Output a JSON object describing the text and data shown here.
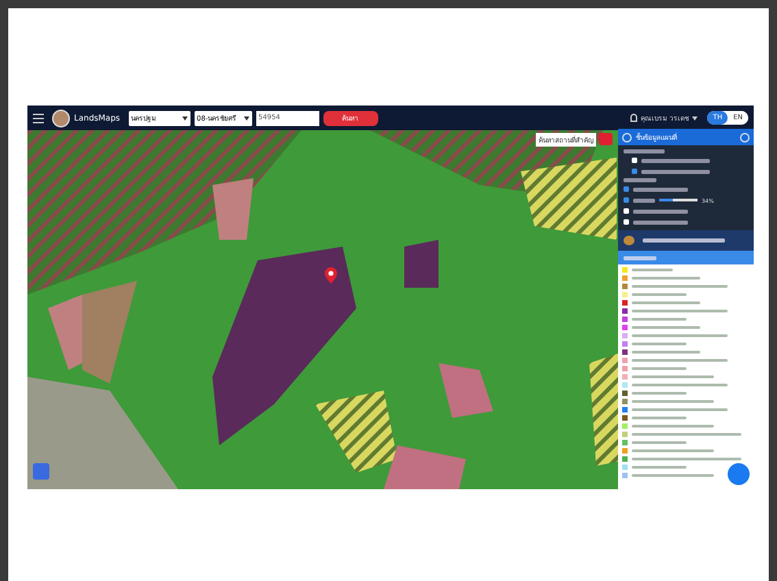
{
  "topbar": {
    "logo": "LandsMaps",
    "province": "นครปฐม",
    "district": "08-นครชัยศรี",
    "parcel_number": "54954",
    "search_button": "ค้นหา",
    "user": "คุณเบรม วรเดช",
    "languages": [
      {
        "label": "TH",
        "selected": true
      },
      {
        "label": "EN",
        "selected": false
      }
    ]
  },
  "map": {
    "tooltip": "ค้นหาสถานที่สำคัญ"
  },
  "panel": {
    "title": "ชั้นข้อมูลแผนที่",
    "basemaps": [
      {
        "selected": false
      },
      {
        "selected": true
      }
    ],
    "layers": [
      {
        "kind": "check",
        "checked": true
      },
      {
        "kind": "slider",
        "checked": true,
        "level": 0.34,
        "reading": "34%"
      },
      {
        "kind": "check",
        "checked": false
      },
      {
        "kind": "check",
        "checked": false
      }
    ],
    "legend": [
      {
        "color": "#f5e61e"
      },
      {
        "color": "#f0a030"
      },
      {
        "color": "#b08a3a"
      },
      {
        "color": "#f5f08a"
      },
      {
        "color": "#e02020"
      },
      {
        "color": "#8a2aa8"
      },
      {
        "color": "#c040e0"
      },
      {
        "color": "#e040f0"
      },
      {
        "color": "#d8b0f0"
      },
      {
        "color": "#c080f0"
      },
      {
        "color": "#803080"
      },
      {
        "color": "#f0a0b0"
      },
      {
        "color": "#f0a0a8"
      },
      {
        "color": "#f0b0b8"
      },
      {
        "color": "#b0e8f0"
      },
      {
        "color": "#606030"
      },
      {
        "color": "#909060"
      },
      {
        "color": "#2080f0"
      },
      {
        "color": "#7a5a20"
      },
      {
        "color": "#a0f060"
      },
      {
        "color": "#c0d080"
      },
      {
        "color": "#60c060"
      },
      {
        "color": "#f0a020"
      },
      {
        "color": "#50b050"
      },
      {
        "color": "#a0e0f0"
      },
      {
        "color": "#a0c0f0"
      }
    ]
  }
}
